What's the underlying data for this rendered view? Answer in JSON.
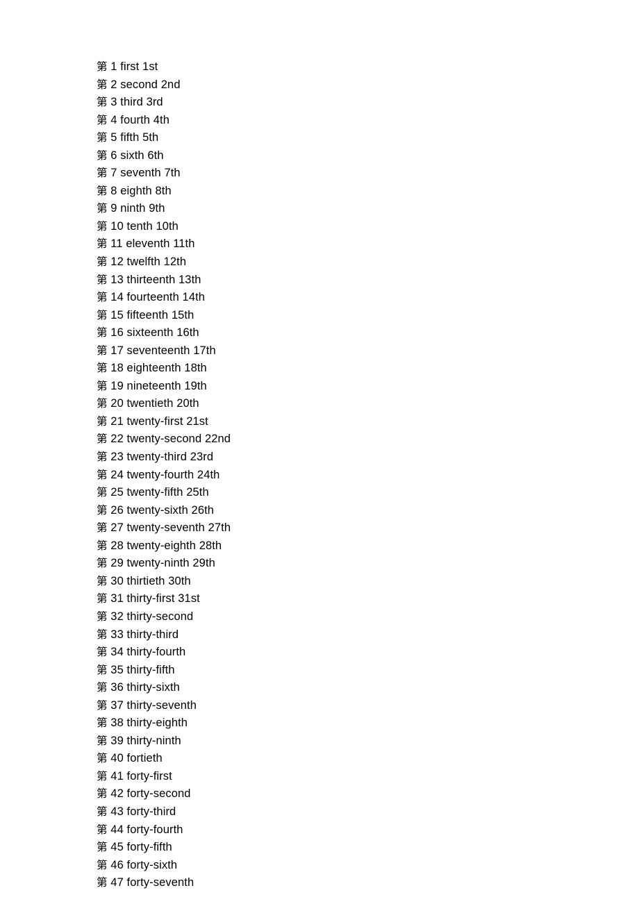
{
  "document": {
    "background_color": "#ffffff",
    "text_color": "#000000",
    "prefix_character": "第",
    "lines": [
      {
        "prefix": "第",
        "number": "1",
        "word": "first",
        "abbr": "1st"
      },
      {
        "prefix": "第",
        "number": "2",
        "word": "second",
        "abbr": "2nd"
      },
      {
        "prefix": "第",
        "number": "3",
        "word": "third",
        "abbr": "3rd"
      },
      {
        "prefix": "第",
        "number": "4",
        "word": "fourth",
        "abbr": "4th"
      },
      {
        "prefix": "第",
        "number": "5",
        "word": "fifth",
        "abbr": "5th"
      },
      {
        "prefix": "第",
        "number": "6",
        "word": "sixth",
        "abbr": "6th"
      },
      {
        "prefix": "第",
        "number": "7",
        "word": "seventh",
        "abbr": "7th"
      },
      {
        "prefix": "第",
        "number": "8",
        "word": "eighth",
        "abbr": "8th"
      },
      {
        "prefix": "第",
        "number": "9",
        "word": "ninth",
        "abbr": "9th"
      },
      {
        "prefix": "第",
        "number": "10",
        "word": "tenth",
        "abbr": "10th"
      },
      {
        "prefix": "第",
        "number": "11",
        "word": "eleventh",
        "abbr": "11th"
      },
      {
        "prefix": "第",
        "number": "12",
        "word": "twelfth",
        "abbr": "12th"
      },
      {
        "prefix": "第",
        "number": "13",
        "word": "thirteenth",
        "abbr": "13th"
      },
      {
        "prefix": "第",
        "number": "14",
        "word": "fourteenth",
        "abbr": "14th"
      },
      {
        "prefix": "第",
        "number": "15",
        "word": "fifteenth",
        "abbr": "15th"
      },
      {
        "prefix": "第",
        "number": "16",
        "word": "sixteenth",
        "abbr": "16th"
      },
      {
        "prefix": "第",
        "number": "17",
        "word": "seventeenth",
        "abbr": "17th"
      },
      {
        "prefix": "第",
        "number": "18",
        "word": "eighteenth",
        "abbr": "18th"
      },
      {
        "prefix": "第",
        "number": "19",
        "word": "nineteenth",
        "abbr": "19th"
      },
      {
        "prefix": "第",
        "number": "20",
        "word": "twentieth",
        "abbr": "20th"
      },
      {
        "prefix": "第",
        "number": "21",
        "word": "twenty-first",
        "abbr": "21st"
      },
      {
        "prefix": "第",
        "number": "22",
        "word": "twenty-second",
        "abbr": "22nd"
      },
      {
        "prefix": "第",
        "number": "23",
        "word": "twenty-third",
        "abbr": "23rd"
      },
      {
        "prefix": "第",
        "number": "24",
        "word": "twenty-fourth",
        "abbr": "24th"
      },
      {
        "prefix": "第",
        "number": "25",
        "word": "twenty-fifth",
        "abbr": "25th"
      },
      {
        "prefix": "第",
        "number": "26",
        "word": "twenty-sixth",
        "abbr": "26th"
      },
      {
        "prefix": "第",
        "number": "27",
        "word": "twenty-seventh",
        "abbr": "27th"
      },
      {
        "prefix": "第",
        "number": "28",
        "word": "twenty-eighth",
        "abbr": "28th"
      },
      {
        "prefix": "第",
        "number": "29",
        "word": "twenty-ninth",
        "abbr": "29th"
      },
      {
        "prefix": "第",
        "number": "30",
        "word": "thirtieth",
        "abbr": "30th"
      },
      {
        "prefix": "第",
        "number": "31",
        "word": "thirty-first",
        "abbr": "31st"
      },
      {
        "prefix": "第",
        "number": "32",
        "word": "thirty-second",
        "abbr": ""
      },
      {
        "prefix": "第",
        "number": "33",
        "word": "thirty-third",
        "abbr": ""
      },
      {
        "prefix": "第",
        "number": "34",
        "word": "thirty-fourth",
        "abbr": ""
      },
      {
        "prefix": "第",
        "number": "35",
        "word": "thirty-fifth",
        "abbr": ""
      },
      {
        "prefix": "第",
        "number": "36",
        "word": "thirty-sixth",
        "abbr": ""
      },
      {
        "prefix": "第",
        "number": "37",
        "word": "thirty-seventh",
        "abbr": ""
      },
      {
        "prefix": "第",
        "number": "38",
        "word": "thirty-eighth",
        "abbr": ""
      },
      {
        "prefix": "第",
        "number": "39",
        "word": "thirty-ninth",
        "abbr": ""
      },
      {
        "prefix": "第",
        "number": "40",
        "word": "fortieth",
        "abbr": ""
      },
      {
        "prefix": "第",
        "number": "41",
        "word": "forty-first",
        "abbr": ""
      },
      {
        "prefix": "第",
        "number": "42",
        "word": "forty-second",
        "abbr": ""
      },
      {
        "prefix": "第",
        "number": "43",
        "word": "forty-third",
        "abbr": ""
      },
      {
        "prefix": "第",
        "number": "44",
        "word": "forty-fourth",
        "abbr": ""
      },
      {
        "prefix": "第",
        "number": "45",
        "word": "forty-fifth",
        "abbr": ""
      },
      {
        "prefix": "第",
        "number": "46",
        "word": "forty-sixth",
        "abbr": ""
      },
      {
        "prefix": "第",
        "number": "47",
        "word": "forty-seventh",
        "abbr": ""
      }
    ]
  }
}
